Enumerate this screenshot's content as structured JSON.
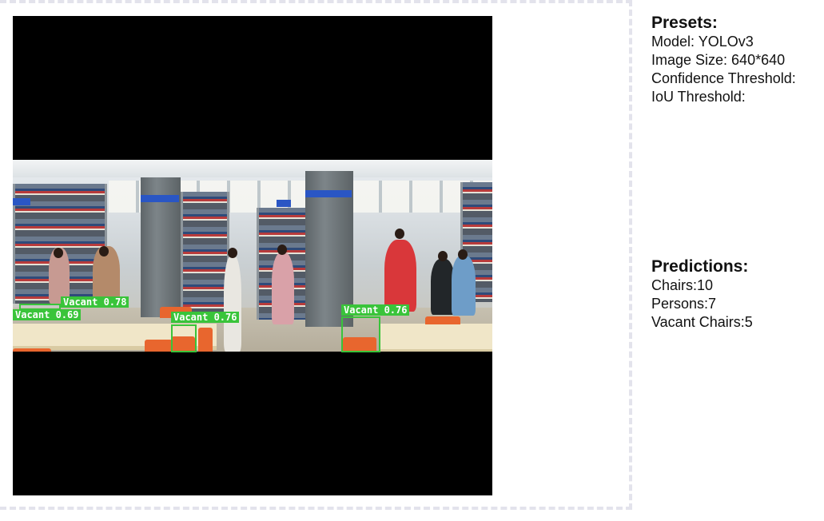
{
  "image": {
    "detections": [
      {
        "label": "Vacant 0.78"
      },
      {
        "label": "Vacant 0.69"
      },
      {
        "label": "Vacant 0.76"
      },
      {
        "label": "Vacant 0.76"
      }
    ]
  },
  "presets": {
    "heading": "Presets:",
    "model": "Model: YOLOv3",
    "image_size": "Image Size: 640*640",
    "confidence": "Confidence Threshold:",
    "iou": "IoU Threshold:"
  },
  "predictions": {
    "heading": "Predictions:",
    "chairs": "Chairs:10",
    "persons": "Persons:7",
    "vacant": "Vacant Chairs:5"
  },
  "colors": {
    "detection": "#39c43a",
    "letterbox": "#000000",
    "border": "#e3e3ec"
  }
}
